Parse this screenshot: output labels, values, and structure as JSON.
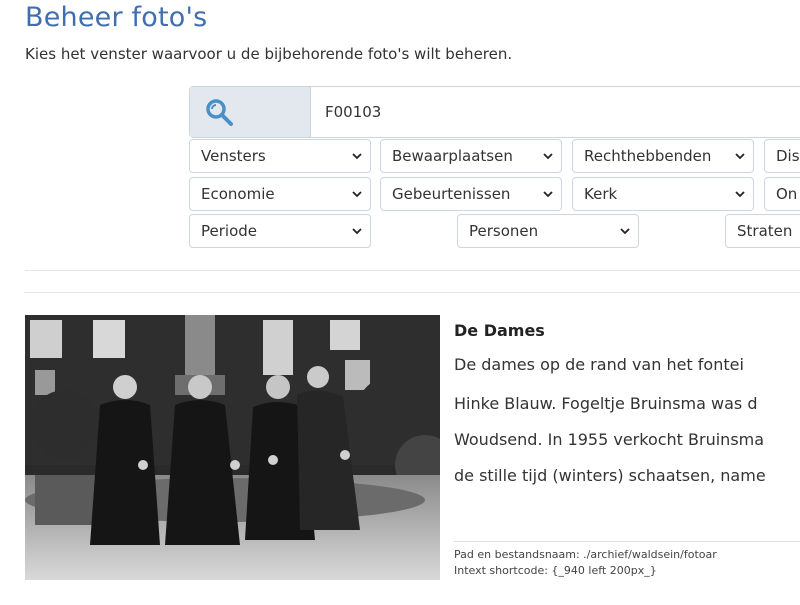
{
  "page": {
    "title": "Beheer foto's",
    "subtitle": "Kies het venster waarvoor u de bijbehorende foto's wilt beheren."
  },
  "search": {
    "icon": "magnifier-icon",
    "value": "F00103"
  },
  "filters": {
    "row1": [
      "Vensters",
      "Bewaarplaatsen",
      "Rechthebbenden",
      "Dis"
    ],
    "row2": [
      "Economie",
      "Gebeurtenissen",
      "Kerk",
      "On"
    ],
    "row3": [
      "Periode",
      "Personen",
      "Straten"
    ]
  },
  "photo": {
    "title": "De Dames",
    "description": [
      "De dames op de rand van het fontei",
      "Hinke Blauw. Fogeltje Bruinsma was d",
      "Woudsend. In 1955 verkocht Bruinsma",
      "de stille tijd (winters) schaatsen, name"
    ],
    "path": "Pad en bestandsnaam: ./archief/waldsein/fotoar",
    "shortcode": "Intext shortcode: {_940 left 200px_}"
  },
  "colors": {
    "title": "#3f6fb0",
    "icon": "#4a90c8",
    "border": "#ccd6e2"
  }
}
